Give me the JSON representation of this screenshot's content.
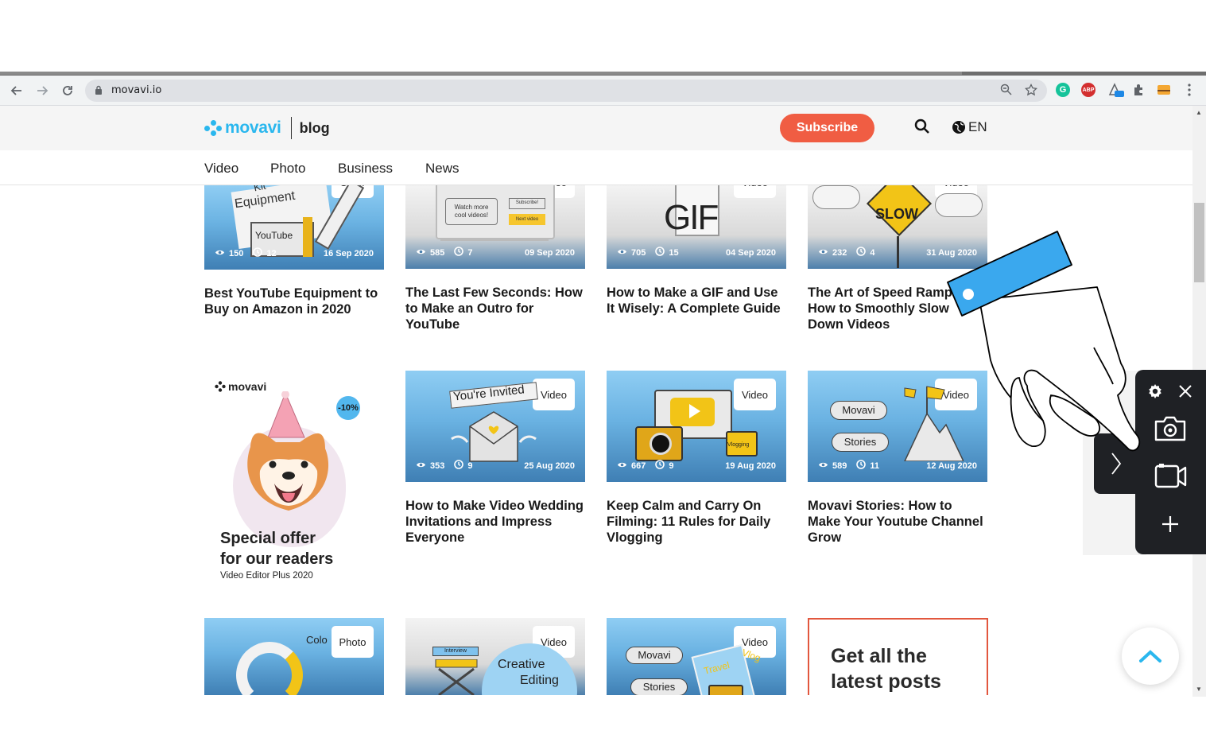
{
  "browser": {
    "url": "movavi.io"
  },
  "header": {
    "logo_name": "movavi",
    "section": "blog",
    "subscribe_label": "Subscribe",
    "language": "EN"
  },
  "nav": {
    "items": [
      "Video",
      "Photo",
      "Business",
      "News"
    ]
  },
  "cards_row1": [
    {
      "badge": "Other",
      "views": "150",
      "minutes": "12",
      "date": "16 Sep 2020",
      "title": "Best YouTube Equipment to Buy on Amazon in 2020",
      "art_words": [
        "Kit",
        "Equipment",
        "YouTube"
      ]
    },
    {
      "badge": "Video",
      "views": "585",
      "minutes": "7",
      "date": "09 Sep 2020",
      "title": "The Last Few Seconds: How to Make an Outro for YouTube",
      "art_words": [
        "Watch more cool videos!",
        "Subscribe!",
        "Next video"
      ]
    },
    {
      "badge": "Video",
      "views": "705",
      "minutes": "15",
      "date": "04 Sep 2020",
      "title": "How to Make a GIF and Use It Wisely: A Complete Guide",
      "art_words": [
        "GIF"
      ]
    },
    {
      "badge": "Video",
      "views": "232",
      "minutes": "4",
      "date": "31 Aug 2020",
      "title": "The Art of Speed Ramping: How to Smoothly Slow Down Videos",
      "art_words": [
        "SLOW"
      ]
    }
  ],
  "promo": {
    "logo": "movavi",
    "discount": "-10%",
    "title_line1": "Special offer",
    "title_line2": "for our readers",
    "subtitle": "Video Editor Plus 2020"
  },
  "cards_row2": [
    {
      "badge": "Video",
      "views": "353",
      "minutes": "9",
      "date": "25 Aug 2020",
      "title": "How to Make Video Wedding Invitations and Impress Everyone",
      "art_words": [
        "You're Invited"
      ]
    },
    {
      "badge": "Video",
      "views": "667",
      "minutes": "9",
      "date": "19 Aug 2020",
      "title": "Keep Calm and Carry On Filming: 11 Rules for Daily Vlogging",
      "art_words": [
        "Vlogging"
      ]
    },
    {
      "badge": "Video",
      "views": "589",
      "minutes": "11",
      "date": "12 Aug 2020",
      "title": "Movavi Stories: How to Make Your Youtube Channel Grow",
      "art_words": [
        "Movavi",
        "Stories"
      ]
    }
  ],
  "cards_row3": [
    {
      "badge": "Photo",
      "art_words": [
        "Colo"
      ]
    },
    {
      "badge": "Video",
      "art_words": [
        "Interview",
        "Creative",
        "Editing"
      ]
    },
    {
      "badge": "Video",
      "art_words": [
        "Movavi",
        "Stories",
        "Travel",
        "Vlog"
      ]
    }
  ],
  "subscribe_box": {
    "line1": "Get all the",
    "line2": "latest posts"
  },
  "colors": {
    "brand_blue": "#2ab7ee",
    "subscribe_red": "#f05d43",
    "tool_panel": "#1f2125",
    "hand_cuff": "#3aa8ee"
  },
  "icons": {
    "toolbar": [
      "back-arrow-icon",
      "forward-arrow-icon",
      "reload-icon",
      "lock-icon",
      "zoom-icon",
      "star-icon",
      "extensions-puzzle-icon",
      "menu-dots-icon"
    ],
    "tool_panel": [
      "gear-icon",
      "close-icon",
      "camera-icon",
      "video-camera-icon",
      "plus-icon",
      "chevron-right-icon"
    ],
    "page": [
      "search-icon",
      "globe-icon",
      "eye-icon",
      "clock-icon",
      "chevron-up-icon",
      "pointing-hand-icon"
    ]
  }
}
